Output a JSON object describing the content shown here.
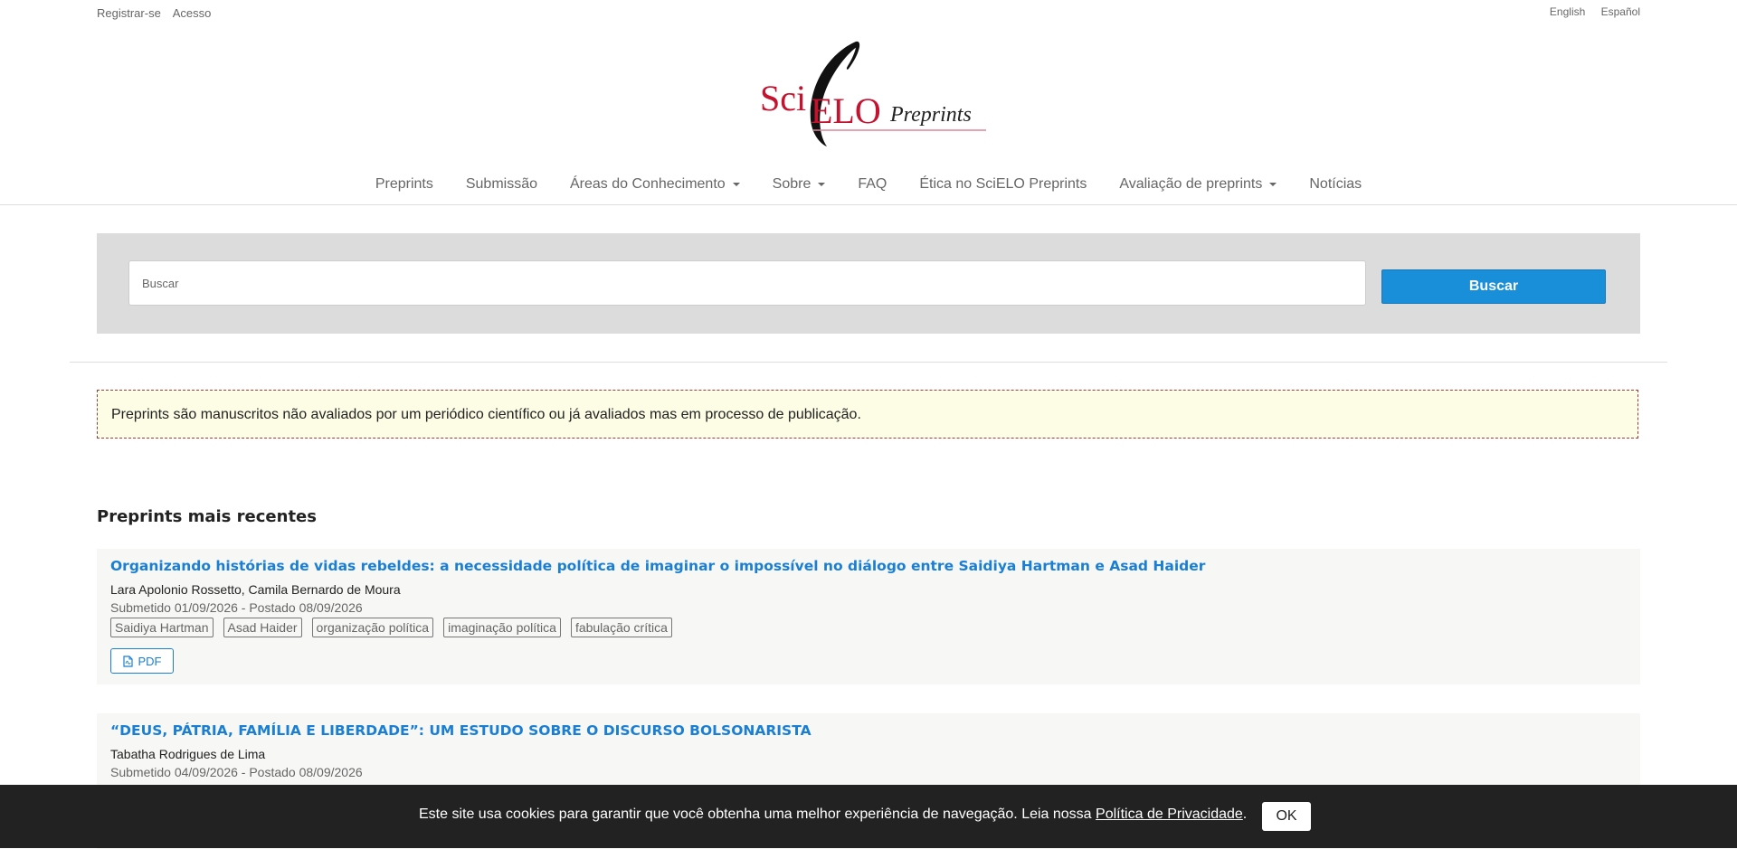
{
  "top_links": {
    "register": "Registrar-se",
    "login": "Acesso"
  },
  "languages": {
    "english": "English",
    "espanol": "Español"
  },
  "logo": {
    "sci": "Sci",
    "elo": "ELO",
    "preprints": "Preprints"
  },
  "nav": {
    "preprints": "Preprints",
    "submissao": "Submissão",
    "areas": "Áreas do Conhecimento",
    "sobre": "Sobre",
    "faq": "FAQ",
    "etica": "Ética no SciELO Preprints",
    "avaliacao": "Avaliação de preprints",
    "noticias": "Notícias"
  },
  "search": {
    "placeholder": "Buscar",
    "button": "Buscar"
  },
  "notice": "Preprints são manuscritos não avaliados por um periódico científico ou já avaliados mas em processo de publicação.",
  "section_title": "Preprints mais recentes",
  "preprints": [
    {
      "title": "Organizando histórias de vidas rebeldes: a necessidade política de imaginar o impossível no diálogo entre Saidiya Hartman e Asad Haider",
      "authors": "Lara Apolonio Rossetto, Camila Bernardo de Moura",
      "dates": "Submetido 01/09/2026 - Postado 08/09/2026",
      "tags": [
        "Saidiya Hartman",
        "Asad Haider",
        "organização política",
        "imaginação política",
        "fabulação crítica"
      ],
      "pdf": "PDF"
    },
    {
      "title": "“DEUS, PÁTRIA, FAMÍLIA E LIBERDADE”: UM ESTUDO SOBRE O DISCURSO BOLSONARISTA",
      "authors": "Tabatha Rodrigues de Lima",
      "dates": "Submetido 04/09/2026 - Postado 08/09/2026"
    }
  ],
  "cookie": {
    "text": "Este site usa cookies para garantir que você obtenha uma melhor experiência de navegação. Leia nossa ",
    "link": "Política de Privacidade",
    "period": ".",
    "ok": "OK"
  },
  "colors": {
    "link_blue": "#1a7fd4",
    "button_blue": "#1a8fd9",
    "logo_red": "#c4122f",
    "cookie_bg": "#222222"
  }
}
